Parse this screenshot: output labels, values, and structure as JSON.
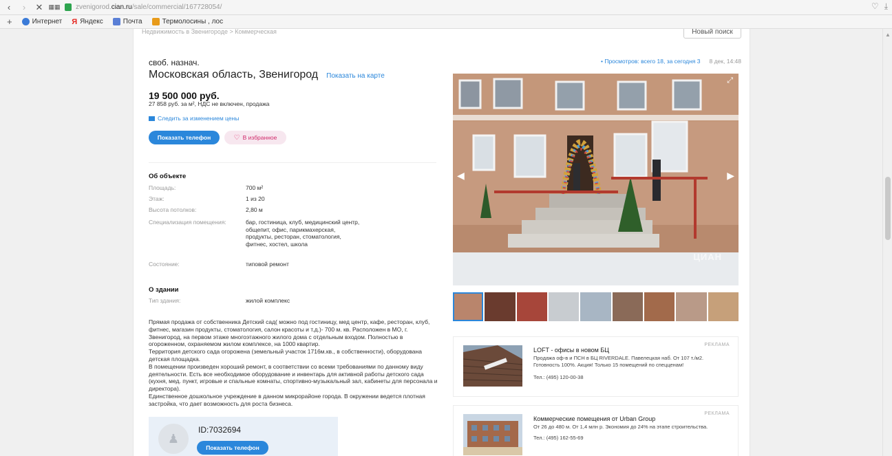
{
  "browser": {
    "url_prefix": "zvenigorod.",
    "url_host": "cian.ru",
    "url_path": "/sale/commercial/167728054/",
    "bookmarks": [
      {
        "label": "Интернет",
        "color": "#3b7bd8"
      },
      {
        "label": "Яндекс",
        "color": "#e52620"
      },
      {
        "label": "Почта",
        "color": "#5a7fd6"
      },
      {
        "label": "Термолосины , лос",
        "color": "#e89b1a"
      }
    ]
  },
  "header": {
    "breadcrumbs": "Недвижимость в Звенигороде > Коммерческая",
    "new_search": "Новый поиск",
    "views": "• Просмотров: всего 18, за сегодня 3",
    "date": "8 дек, 14:48"
  },
  "listing": {
    "type": "своб. назнач.",
    "address": "Московская область, Звенигород",
    "show_on_map": "Показать на карте",
    "price": "19 500 000 руб.",
    "price_sub": "27 858 руб. за м², НДС не включен, продажа",
    "follow_price": "Следить за изменением цены",
    "show_phone": "Показать телефон",
    "favorite": "В избранное"
  },
  "about_object": {
    "title": "Об объекте",
    "rows": [
      {
        "k": "Площадь:",
        "v": "700 м²"
      },
      {
        "k": "Этаж:",
        "v": "1 из 20"
      },
      {
        "k": "Высота потолков:",
        "v": "2,80 м"
      },
      {
        "k": "Специализация помещения:",
        "v": "бар, гостиница, клуб, медицинский центр, общепит, офис, парикмахерская, продукты, ресторан, стоматология, фитнес, хостел, школа"
      },
      {
        "k": "Состояние:",
        "v": "типовой ремонт"
      }
    ]
  },
  "about_building": {
    "title": "О здании",
    "rows": [
      {
        "k": "Тип здания:",
        "v": "жилой комплекс"
      }
    ]
  },
  "description": "Прямая продажа от собственника Детский сад( можно под гостиницу, мед центр, кафе, ресторан, клуб, фитнес, магазин продукты, стоматология, салон красоты и т.д.)- 700 м. кв. Расположен в МО, г. Звенигород, на первом этаже многоэтажного жилого дома с отдельным входом. Полностью в огороженном, охраняемом жилом комплексе, на 1000 квартир.\nТерритория детского сада огорожена (земельный участок 1716м.кв., в собственности), оборудована детская площадка.\nВ помещении произведен хороший ремонт, в соответствии со всеми требованиями по данному виду деятельности. Есть все необходимое оборудование и инвентарь для активной работы детского сада (кухня, мед. пункт, игровые и спальные комнаты, спортивно-музыкальный зал, кабинеты для персонала и директора).\nЕдинственное дошкольное учреждение в данном микрорайоне города. В окружении ведется плотная застройка, что дает возможность для роста бизнеса.",
  "agent": {
    "id": "ID:7032694",
    "show_phone": "Показать телефон"
  },
  "gallery": {
    "watermark": "ЦИАН",
    "thumb_colors": [
      "#b9856c",
      "#6a3b2e",
      "#a7463a",
      "#c8ccd0",
      "#a8b6c4",
      "#8a6a58",
      "#a26a4b",
      "#b99a88",
      "#c6a07a"
    ]
  },
  "ads": [
    {
      "tag": "РЕКЛАМА",
      "title": "LOFT - офисы в новом БЦ",
      "text": "Продажа оф-в и ПСН в БЦ RIVERDALE. Павелецкая наб. От 107 т./м2. Готовность 100%. Акция! Только 15 помещений по спецценам!",
      "phone": "Тел.: (495) 120-00-38"
    },
    {
      "tag": "РЕКЛАМА",
      "title": "Коммерческие помещения от Urban Group",
      "text": "От 26 до 480 м. От 1,4 млн р. Экономия до 24% на этапе строительства.",
      "phone": "Тел.: (495) 162-55-69"
    }
  ],
  "colors": {
    "accent": "#2b87db",
    "favorite": "#d02a6a"
  }
}
